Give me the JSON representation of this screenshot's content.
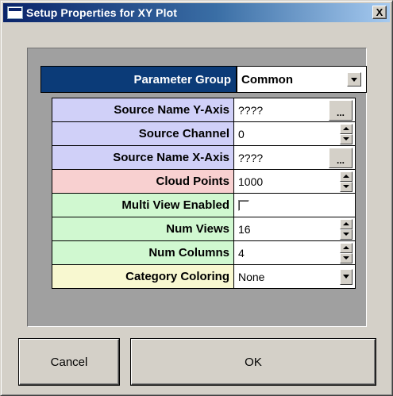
{
  "window": {
    "title": "Setup Properties for XY Plot",
    "close_label": "X"
  },
  "parameter_group": {
    "label": "Parameter Group",
    "value": "Common"
  },
  "properties": [
    {
      "label": "Source Name Y-Axis",
      "value": "????",
      "control": "browse",
      "color": "#d0d0f8"
    },
    {
      "label": "Source Channel",
      "value": "0",
      "control": "spinner",
      "color": "#d0d0f8"
    },
    {
      "label": "Source Name X-Axis",
      "value": "????",
      "control": "browse",
      "color": "#d0d0f8"
    },
    {
      "label": "Cloud Points",
      "value": "1000",
      "control": "spinner",
      "color": "#f8d0d0"
    },
    {
      "label": "Multi View Enabled",
      "value": "",
      "control": "checkbox",
      "checked": false,
      "color": "#d0f8d0"
    },
    {
      "label": "Num Views",
      "value": "16",
      "control": "spinner",
      "color": "#d0f8d0"
    },
    {
      "label": "Num Columns",
      "value": "4",
      "control": "spinner",
      "color": "#d0f8d0"
    },
    {
      "label": "Category Coloring",
      "value": "None",
      "control": "combo",
      "color": "#f8f8d0"
    }
  ],
  "browse_label": "...",
  "buttons": {
    "cancel": "Cancel",
    "ok": "OK"
  }
}
